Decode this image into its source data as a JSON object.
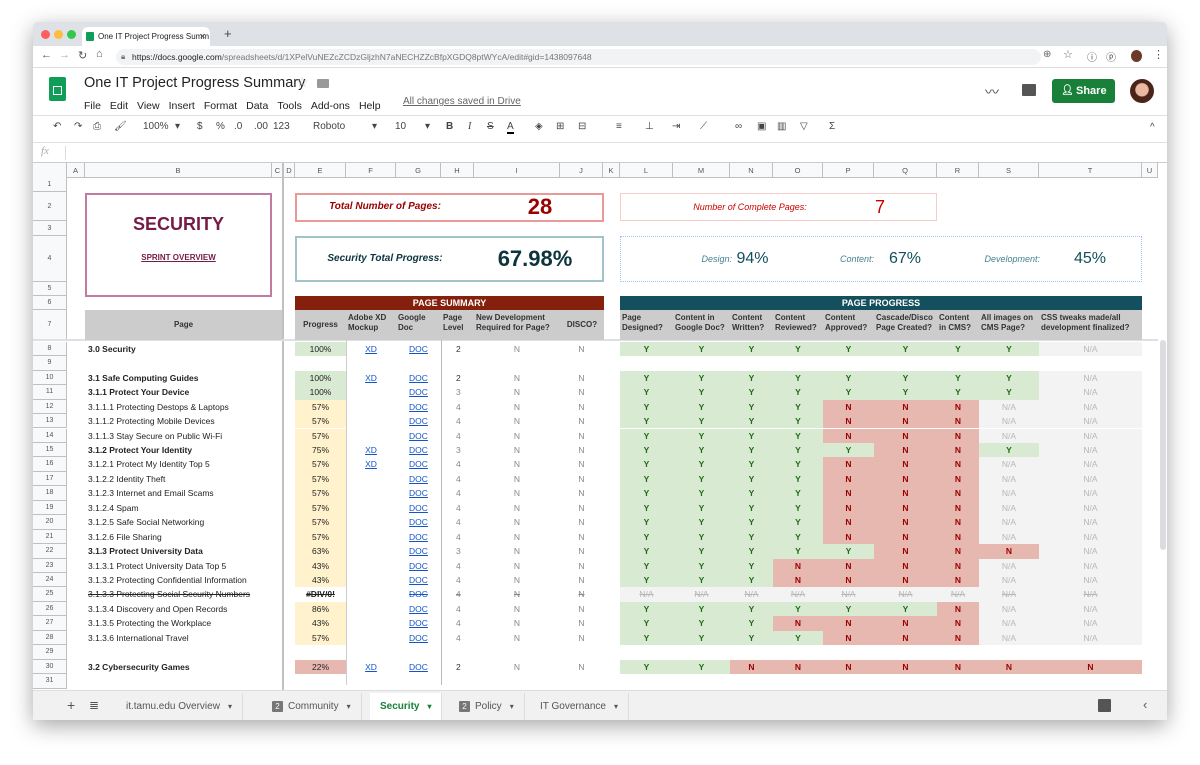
{
  "browser": {
    "tab_title": "One IT Project Progress Summ",
    "url_host": "https://docs.google.com",
    "url_path": "/spreadsheets/d/1XPelVuNEZcZCDzGljzhN7aNECHZZcBfpXGDQ8ptWYcA/edit#gid=1438097648"
  },
  "doc": {
    "title": "One IT Project Progress Summary",
    "menu": [
      "File",
      "Edit",
      "View",
      "Insert",
      "Format",
      "Data",
      "Tools",
      "Add-ons",
      "Help"
    ],
    "save_status": "All changes saved in Drive",
    "share_label": "Share",
    "share_color": "#188038"
  },
  "toolbar": {
    "zoom": "100%",
    "currency": "$",
    "percent": "%",
    "dec_less": ".0",
    "dec_more": ".00",
    "format_more": "123",
    "font": "Roboto",
    "font_size": "10",
    "bold": "B",
    "italic": "I",
    "strike": "S",
    "text_color": "A",
    "sum": "Σ"
  },
  "formula_bar": {
    "fx": "fx",
    "value": ""
  },
  "columns": [
    "A",
    "B",
    "C",
    "D",
    "E",
    "F",
    "G",
    "H",
    "I",
    "J",
    "K",
    "L",
    "M",
    "N",
    "O",
    "P",
    "Q",
    "R",
    "S",
    "T",
    "U"
  ],
  "dashboard": {
    "section_title": "SECURITY",
    "sprint_link": "SPRINT OVERVIEW",
    "total_pages_label": "Total Number of Pages:",
    "total_pages": "28",
    "complete_pages_label": "Number of Complete Pages:",
    "complete_pages": "7",
    "total_progress_label": "Security Total Progress:",
    "total_progress": "67.98%",
    "design_label": "Design:",
    "design": "94%",
    "content_label": "Content:",
    "content": "67%",
    "development_label": "Development:",
    "development": "45%",
    "page_summary_title": "PAGE SUMMARY",
    "page_progress_title": "PAGE PROGRESS",
    "page_summary_color": "#85200c",
    "page_progress_color": "#134f5c"
  },
  "headers": {
    "page": "Page",
    "summary": [
      "Progress",
      "Adobe XD Mockup",
      "Google Doc",
      "Page Level",
      "New Development Required for Page?",
      "DISCO?"
    ],
    "progress": [
      "Page Designed?",
      "Content in Google Doc?",
      "Content Written?",
      "Content Reviewed?",
      "Content Approved?",
      "Cascade/Disco Page Created?",
      "Content in CMS?",
      "All images on CMS Page?",
      "CSS tweaks made/all development finalized?"
    ]
  },
  "status_colors": {
    "green": "#d9ead3",
    "yellow": "#fff2cc",
    "red": "#e6b8af"
  },
  "rows": [
    {
      "num": "8",
      "page": "3.0 Security",
      "bold": true,
      "progress": "100%",
      "fill": "green",
      "xd": "XD",
      "doc": "DOC",
      "level": "2",
      "new_dev": "N",
      "disco": "N",
      "checks": [
        "Y",
        "Y",
        "Y",
        "Y",
        "Y",
        "Y",
        "Y",
        "Y",
        "N/A"
      ]
    },
    {
      "num": "9"
    },
    {
      "num": "10",
      "page": "3.1 Safe Computing Guides",
      "bold": true,
      "progress": "100%",
      "fill": "green",
      "xd": "XD",
      "doc": "DOC",
      "level": "2",
      "new_dev": "N",
      "disco": "N",
      "checks": [
        "Y",
        "Y",
        "Y",
        "Y",
        "Y",
        "Y",
        "Y",
        "Y",
        "N/A"
      ]
    },
    {
      "num": "11",
      "page": "3.1.1 Protect Your Device",
      "bold": true,
      "progress": "100%",
      "fill": "green",
      "doc": "DOC",
      "level": "3",
      "new_dev": "N",
      "disco": "N",
      "checks": [
        "Y",
        "Y",
        "Y",
        "Y",
        "Y",
        "Y",
        "Y",
        "Y",
        "N/A"
      ]
    },
    {
      "num": "12",
      "page": "3.1.1.1 Protecting Destops & Laptops",
      "progress": "57%",
      "fill": "yellow",
      "doc": "DOC",
      "level": "4",
      "new_dev": "N",
      "disco": "N",
      "checks": [
        "Y",
        "Y",
        "Y",
        "Y",
        "N",
        "N",
        "N",
        "N/A",
        "N/A"
      ]
    },
    {
      "num": "13",
      "page": "3.1.1.2 Protecting Mobile Devices",
      "progress": "57%",
      "fill": "yellow",
      "doc": "DOC",
      "level": "4",
      "new_dev": "N",
      "disco": "N",
      "checks": [
        "Y",
        "Y",
        "Y",
        "Y",
        "N",
        "N",
        "N",
        "N/A",
        "N/A"
      ]
    },
    {
      "num": "14",
      "page": "3.1.1.3 Stay Secure on Public Wi-Fi",
      "progress": "57%",
      "fill": "yellow",
      "doc": "DOC",
      "level": "4",
      "new_dev": "N",
      "disco": "N",
      "checks": [
        "Y",
        "Y",
        "Y",
        "Y",
        "N",
        "N",
        "N",
        "N/A",
        "N/A"
      ]
    },
    {
      "num": "15",
      "page": "3.1.2 Protect Your Identity",
      "bold": true,
      "progress": "75%",
      "fill": "yellow",
      "xd": "XD",
      "doc": "DOC",
      "level": "3",
      "new_dev": "N",
      "disco": "N",
      "checks": [
        "Y",
        "Y",
        "Y",
        "Y",
        "Y",
        "N",
        "N",
        "Y",
        "N/A"
      ]
    },
    {
      "num": "16",
      "page": "3.1.2.1 Protect My Identity Top 5",
      "progress": "57%",
      "fill": "yellow",
      "xd": "XD",
      "doc": "DOC",
      "level": "4",
      "new_dev": "N",
      "disco": "N",
      "checks": [
        "Y",
        "Y",
        "Y",
        "Y",
        "N",
        "N",
        "N",
        "N/A",
        "N/A"
      ]
    },
    {
      "num": "17",
      "page": "3.1.2.2 Identity Theft",
      "progress": "57%",
      "fill": "yellow",
      "doc": "DOC",
      "level": "4",
      "new_dev": "N",
      "disco": "N",
      "checks": [
        "Y",
        "Y",
        "Y",
        "Y",
        "N",
        "N",
        "N",
        "N/A",
        "N/A"
      ]
    },
    {
      "num": "18",
      "page": "3.1.2.3 Internet and Email Scams",
      "progress": "57%",
      "fill": "yellow",
      "doc": "DOC",
      "level": "4",
      "new_dev": "N",
      "disco": "N",
      "checks": [
        "Y",
        "Y",
        "Y",
        "Y",
        "N",
        "N",
        "N",
        "N/A",
        "N/A"
      ]
    },
    {
      "num": "19",
      "page": "3.1.2.4 Spam",
      "progress": "57%",
      "fill": "yellow",
      "doc": "DOC",
      "level": "4",
      "new_dev": "N",
      "disco": "N",
      "checks": [
        "Y",
        "Y",
        "Y",
        "Y",
        "N",
        "N",
        "N",
        "N/A",
        "N/A"
      ]
    },
    {
      "num": "20",
      "page": "3.1.2.5 Safe Social Networking",
      "progress": "57%",
      "fill": "yellow",
      "doc": "DOC",
      "level": "4",
      "new_dev": "N",
      "disco": "N",
      "checks": [
        "Y",
        "Y",
        "Y",
        "Y",
        "N",
        "N",
        "N",
        "N/A",
        "N/A"
      ]
    },
    {
      "num": "21",
      "page": "3.1.2.6 File Sharing",
      "progress": "57%",
      "fill": "yellow",
      "doc": "DOC",
      "level": "4",
      "new_dev": "N",
      "disco": "N",
      "checks": [
        "Y",
        "Y",
        "Y",
        "Y",
        "N",
        "N",
        "N",
        "N/A",
        "N/A"
      ]
    },
    {
      "num": "22",
      "page": "3.1.3 Protect University Data",
      "bold": true,
      "progress": "63%",
      "fill": "yellow",
      "doc": "DOC",
      "level": "3",
      "new_dev": "N",
      "disco": "N",
      "checks": [
        "Y",
        "Y",
        "Y",
        "Y",
        "Y",
        "N",
        "N",
        "N",
        "N/A"
      ]
    },
    {
      "num": "23",
      "page": "3.1.3.1 Protect University Data Top 5",
      "progress": "43%",
      "fill": "yellow",
      "doc": "DOC",
      "level": "4",
      "new_dev": "N",
      "disco": "N",
      "checks": [
        "Y",
        "Y",
        "Y",
        "N",
        "N",
        "N",
        "N",
        "N/A",
        "N/A"
      ]
    },
    {
      "num": "24",
      "page": "3.1.3.2 Protecting Confidential Information",
      "progress": "43%",
      "fill": "yellow",
      "doc": "DOC",
      "level": "4",
      "new_dev": "N",
      "disco": "N",
      "checks": [
        "Y",
        "Y",
        "Y",
        "N",
        "N",
        "N",
        "N",
        "N/A",
        "N/A"
      ]
    },
    {
      "num": "25",
      "page": "3.1.3.3 Protecting Social Security Numbers",
      "strike": true,
      "progress": "#DIV/0!",
      "fill": "none",
      "doc": "DOC",
      "level": "4",
      "new_dev": "N",
      "disco": "N",
      "checks": [
        "N/A",
        "N/A",
        "N/A",
        "N/A",
        "N/A",
        "N/A",
        "N/A",
        "N/A",
        "N/A"
      ]
    },
    {
      "num": "26",
      "page": "3.1.3.4 Discovery and Open Records",
      "progress": "86%",
      "fill": "yellow",
      "doc": "DOC",
      "level": "4",
      "new_dev": "N",
      "disco": "N",
      "checks": [
        "Y",
        "Y",
        "Y",
        "Y",
        "Y",
        "Y",
        "N",
        "N/A",
        "N/A"
      ]
    },
    {
      "num": "27",
      "page": "3.1.3.5 Protecting the Workplace",
      "progress": "43%",
      "fill": "yellow",
      "doc": "DOC",
      "level": "4",
      "new_dev": "N",
      "disco": "N",
      "checks": [
        "Y",
        "Y",
        "Y",
        "N",
        "N",
        "N",
        "N",
        "N/A",
        "N/A"
      ]
    },
    {
      "num": "28",
      "page": "3.1.3.6 International Travel",
      "progress": "57%",
      "fill": "yellow",
      "doc": "DOC",
      "level": "4",
      "new_dev": "N",
      "disco": "N",
      "checks": [
        "Y",
        "Y",
        "Y",
        "Y",
        "N",
        "N",
        "N",
        "N/A",
        "N/A"
      ]
    },
    {
      "num": "29"
    },
    {
      "num": "30",
      "page": "3.2 Cybersecurity Games",
      "bold": true,
      "progress": "22%",
      "fill": "red",
      "xd": "XD",
      "doc": "DOC",
      "level": "2",
      "new_dev": "N",
      "disco": "N",
      "checks": [
        "Y",
        "Y",
        "N",
        "N",
        "N",
        "N",
        "N",
        "N",
        "N"
      ]
    },
    {
      "num": "31"
    }
  ],
  "top_row_numbers": [
    "1",
    "2",
    "3",
    "4",
    "5",
    "6",
    "7"
  ],
  "sheet_tabs": [
    {
      "label": "it.tamu.edu Overview",
      "badge": ""
    },
    {
      "label": "Community",
      "badge": "2"
    },
    {
      "label": "Security",
      "badge": "",
      "active": true
    },
    {
      "label": "Policy",
      "badge": "2"
    },
    {
      "label": "IT Governance",
      "badge": ""
    }
  ]
}
